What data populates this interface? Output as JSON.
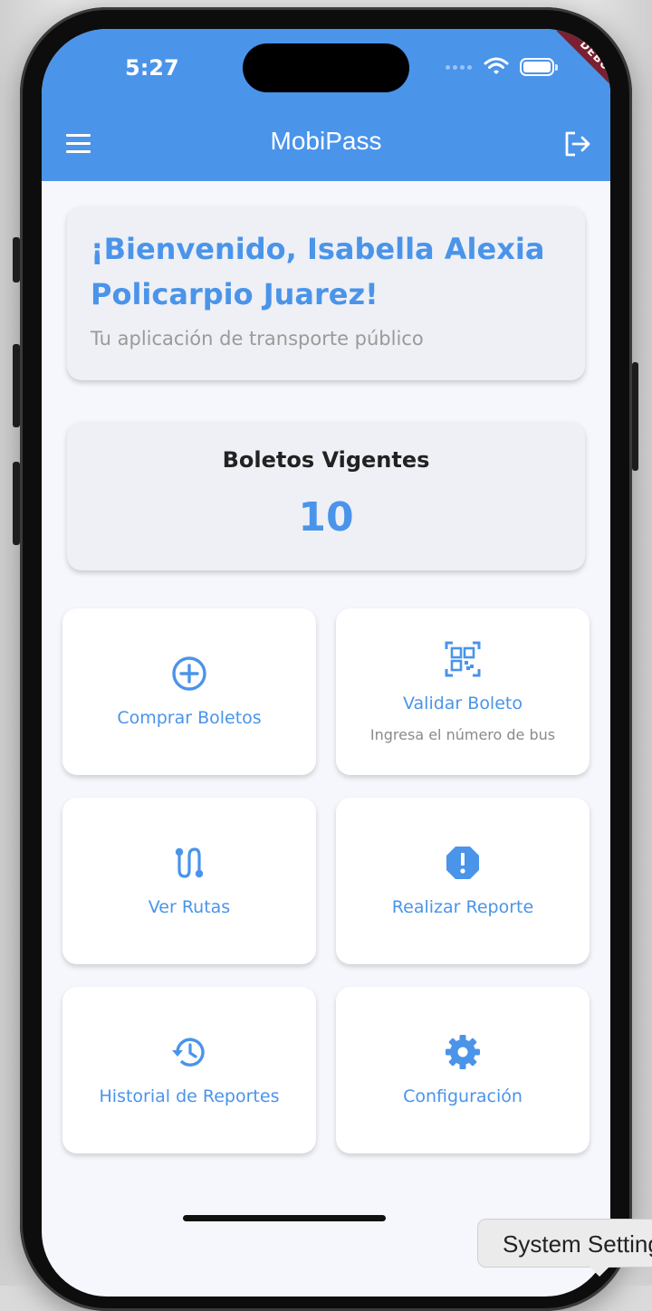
{
  "status_bar": {
    "time": "5:27",
    "debug_label": "DEBUG"
  },
  "app_bar": {
    "title": "MobiPass",
    "menu_icon": "menu-icon",
    "logout_icon": "logout-icon",
    "color": "#4a94ea"
  },
  "welcome": {
    "title": "¡Bienvenido, Isabella Alexia Policarpio Juarez!",
    "subtitle": "Tu aplicación de transporte público"
  },
  "tickets": {
    "label": "Boletos Vigentes",
    "count": "10"
  },
  "actions": [
    {
      "label": "Comprar Boletos",
      "icon": "add-circle-icon"
    },
    {
      "label": "Validar Boleto",
      "sublabel": "Ingresa el número de bus",
      "icon": "qr-code-icon"
    },
    {
      "label": "Ver Rutas",
      "icon": "route-icon"
    },
    {
      "label": "Realizar Reporte",
      "icon": "report-icon"
    },
    {
      "label": "Historial de Reportes",
      "icon": "history-icon"
    },
    {
      "label": "Configuración",
      "icon": "settings-icon"
    }
  ],
  "tooltip": {
    "text": "System Settings"
  },
  "colors": {
    "accent": "#4a94ea",
    "background": "#f5f7fc",
    "debug_banner": "#7a2030"
  }
}
